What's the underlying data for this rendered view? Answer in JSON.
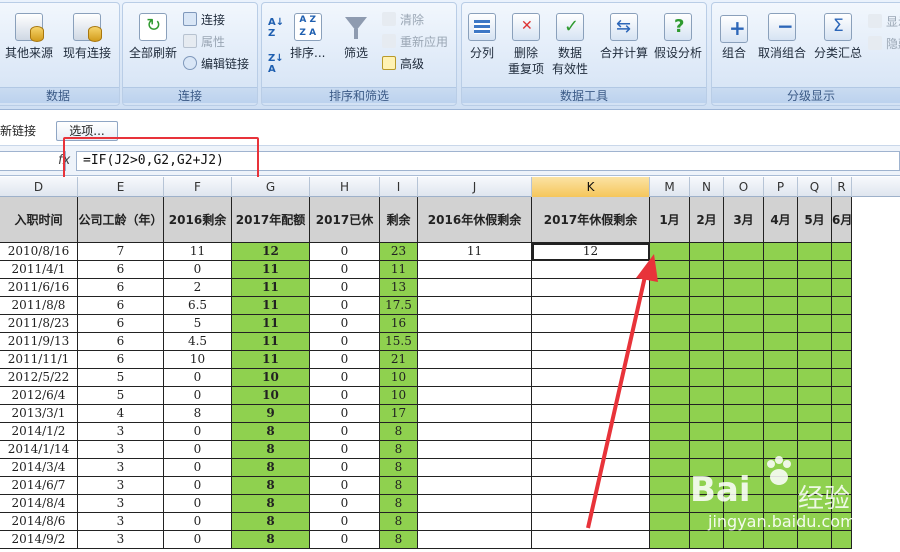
{
  "ribbon": {
    "groups": [
      {
        "label": "数据",
        "buttons": [
          "其他来源",
          "现有连接"
        ]
      },
      {
        "label": "连接",
        "buttons": [
          "全部刷新"
        ],
        "small": [
          {
            "label": "连接",
            "enabled": true
          },
          {
            "label": "属性",
            "enabled": false
          },
          {
            "label": "编辑链接",
            "enabled": true
          }
        ]
      },
      {
        "label": "排序和筛选",
        "buttons": [
          "排序...",
          "筛选"
        ],
        "small": [
          {
            "label": "清除",
            "enabled": false
          },
          {
            "label": "重新应用",
            "enabled": false
          },
          {
            "label": "高级",
            "enabled": true
          }
        ]
      },
      {
        "label": "数据工具",
        "buttons": [
          "分列",
          "删除\n重复项",
          "数据\n有效性",
          "合并计算",
          "假设分析"
        ]
      },
      {
        "label": "分级显示",
        "buttons": [
          "组合",
          "取消组合",
          "分类汇总"
        ],
        "small": [
          {
            "label": "显示",
            "enabled": false
          },
          {
            "label": "隐藏",
            "enabled": false
          }
        ]
      }
    ]
  },
  "msgbar": {
    "text": "新链接",
    "options_label": "选项..."
  },
  "formula_bar": {
    "fx": "fx",
    "formula": "=IF(J2>0,G2,G2+J2)"
  },
  "columns": [
    "D",
    "E",
    "F",
    "G",
    "H",
    "I",
    "J",
    "K",
    "M",
    "N",
    "O",
    "P",
    "Q",
    "R"
  ],
  "selected_column": "K",
  "headers": [
    "入职时间",
    "公司工龄（年）",
    "2016剩余",
    "2017年配额",
    "2017已休",
    "剩余",
    "2016年休假剩余",
    "2017年休假剩余",
    "1月",
    "2月",
    "3月",
    "4月",
    "5月",
    "6月"
  ],
  "rows": [
    [
      "2010/8/16",
      "7",
      "11",
      "12",
      "0",
      "23",
      "11",
      "12"
    ],
    [
      "2011/4/1",
      "6",
      "0",
      "11",
      "0",
      "11",
      "",
      ""
    ],
    [
      "2011/6/16",
      "6",
      "2",
      "11",
      "0",
      "13",
      "",
      ""
    ],
    [
      "2011/8/8",
      "6",
      "6.5",
      "11",
      "0",
      "17.5",
      "",
      ""
    ],
    [
      "2011/8/23",
      "6",
      "5",
      "11",
      "0",
      "16",
      "",
      ""
    ],
    [
      "2011/9/13",
      "6",
      "4.5",
      "11",
      "0",
      "15.5",
      "",
      ""
    ],
    [
      "2011/11/1",
      "6",
      "10",
      "11",
      "0",
      "21",
      "",
      ""
    ],
    [
      "2012/5/22",
      "5",
      "0",
      "10",
      "0",
      "10",
      "",
      ""
    ],
    [
      "2012/6/4",
      "5",
      "0",
      "10",
      "0",
      "10",
      "",
      ""
    ],
    [
      "2013/3/1",
      "4",
      "8",
      "9",
      "0",
      "17",
      "",
      ""
    ],
    [
      "2014/1/2",
      "3",
      "0",
      "8",
      "0",
      "8",
      "",
      ""
    ],
    [
      "2014/1/14",
      "3",
      "0",
      "8",
      "0",
      "8",
      "",
      ""
    ],
    [
      "2014/3/4",
      "3",
      "0",
      "8",
      "0",
      "8",
      "",
      ""
    ],
    [
      "2014/6/7",
      "3",
      "0",
      "8",
      "0",
      "8",
      "",
      ""
    ],
    [
      "2014/8/4",
      "3",
      "0",
      "8",
      "0",
      "8",
      "",
      ""
    ],
    [
      "2014/8/6",
      "3",
      "0",
      "8",
      "0",
      "8",
      "",
      ""
    ],
    [
      "2014/9/2",
      "3",
      "0",
      "8",
      "0",
      "8",
      "",
      ""
    ]
  ],
  "watermark": {
    "logo": "Bai",
    "cn": "经验",
    "url": "jingyan.baidu.com"
  },
  "colors": {
    "green": "#8fd14f",
    "header_gray": "#d2d2d2",
    "annotation_red": "#e8333a",
    "selected_col": "#f5c65b"
  }
}
